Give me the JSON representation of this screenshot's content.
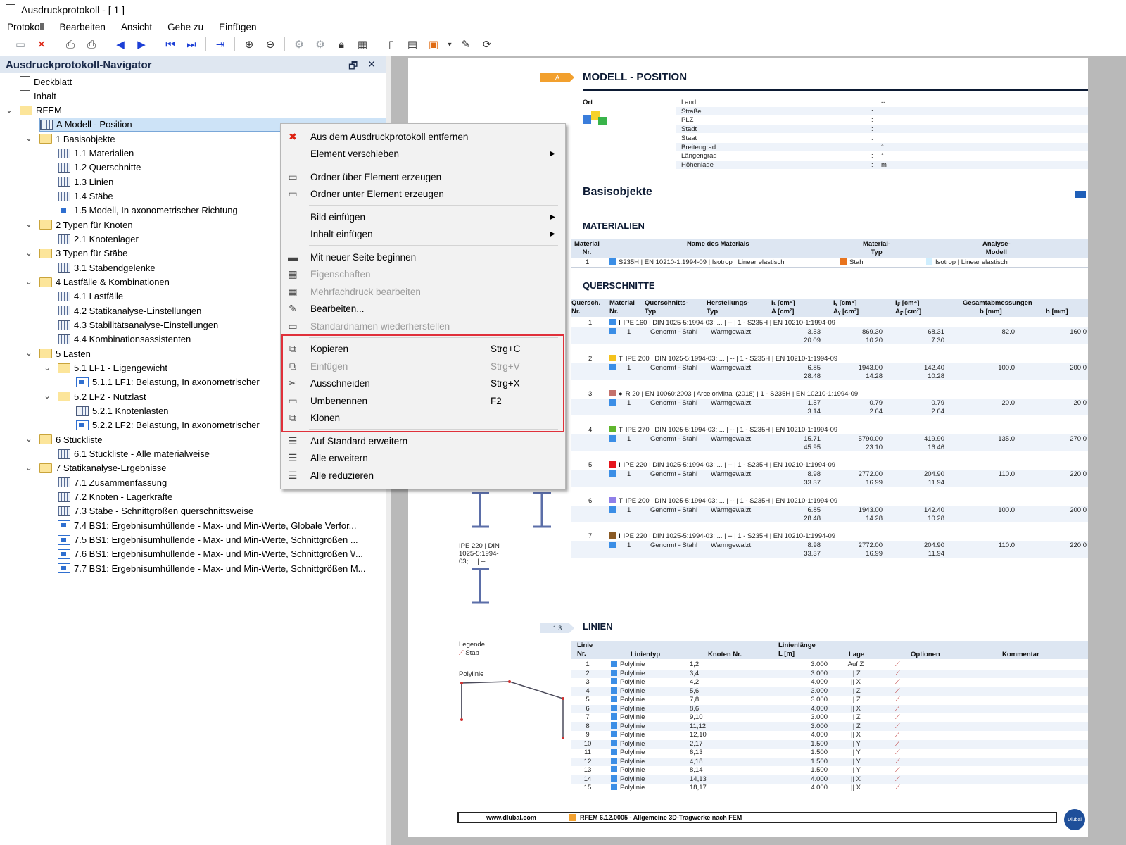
{
  "window": {
    "title": "Ausdruckprotokoll - [ 1 ]"
  },
  "menu": [
    "Protokoll",
    "Bearbeiten",
    "Ansicht",
    "Gehe zu",
    "Einfügen"
  ],
  "navigator": {
    "title": "Ausdruckprotokoll-Navigator",
    "items": [
      {
        "label": "Deckblatt",
        "level": 0,
        "icon": "doc",
        "toggle": ""
      },
      {
        "label": "Inhalt",
        "level": 0,
        "icon": "doc",
        "toggle": ""
      },
      {
        "label": "RFEM",
        "level": 0,
        "icon": "folder",
        "toggle": "v"
      },
      {
        "label": "A Modell - Position",
        "level": 1,
        "icon": "table",
        "toggle": "",
        "selected": true
      },
      {
        "label": "1 Basisobjekte",
        "level": 1,
        "icon": "folder",
        "toggle": "v"
      },
      {
        "label": "1.1 Materialien",
        "level": 2,
        "icon": "table",
        "toggle": ""
      },
      {
        "label": "1.2 Querschnitte",
        "level": 2,
        "icon": "table",
        "toggle": ""
      },
      {
        "label": "1.3 Linien",
        "level": 2,
        "icon": "table",
        "toggle": ""
      },
      {
        "label": "1.4 Stäbe",
        "level": 2,
        "icon": "table",
        "toggle": ""
      },
      {
        "label": "1.5 Modell, In axonometrischer Richtung",
        "level": 2,
        "icon": "img",
        "toggle": ""
      },
      {
        "label": "2 Typen für Knoten",
        "level": 1,
        "icon": "folder",
        "toggle": "v"
      },
      {
        "label": "2.1 Knotenlager",
        "level": 2,
        "icon": "table",
        "toggle": ""
      },
      {
        "label": "3 Typen für Stäbe",
        "level": 1,
        "icon": "folder",
        "toggle": "v"
      },
      {
        "label": "3.1 Stabendgelenke",
        "level": 2,
        "icon": "table",
        "toggle": ""
      },
      {
        "label": "4 Lastfälle & Kombinationen",
        "level": 1,
        "icon": "folder",
        "toggle": "v"
      },
      {
        "label": "4.1 Lastfälle",
        "level": 2,
        "icon": "table",
        "toggle": ""
      },
      {
        "label": "4.2 Statikanalyse-Einstellungen",
        "level": 2,
        "icon": "table",
        "toggle": ""
      },
      {
        "label": "4.3 Stabilitätsanalyse-Einstellungen",
        "level": 2,
        "icon": "table",
        "toggle": ""
      },
      {
        "label": "4.4 Kombinationsassistenten",
        "level": 2,
        "icon": "table",
        "toggle": ""
      },
      {
        "label": "5 Lasten",
        "level": 1,
        "icon": "folder",
        "toggle": "v"
      },
      {
        "label": "5.1 LF1 - Eigengewicht",
        "level": 2,
        "icon": "folder",
        "toggle": "v"
      },
      {
        "label": "5.1.1 LF1: Belastung, In axonometrischer",
        "level": 3,
        "icon": "img",
        "toggle": ""
      },
      {
        "label": "5.2 LF2 - Nutzlast",
        "level": 2,
        "icon": "folder",
        "toggle": "v"
      },
      {
        "label": "5.2.1 Knotenlasten",
        "level": 3,
        "icon": "table",
        "toggle": ""
      },
      {
        "label": "5.2.2 LF2: Belastung, In axonometrischer",
        "level": 3,
        "icon": "img",
        "toggle": ""
      },
      {
        "label": "6 Stückliste",
        "level": 1,
        "icon": "folder",
        "toggle": "v"
      },
      {
        "label": "6.1 Stückliste - Alle materialweise",
        "level": 2,
        "icon": "table",
        "toggle": ""
      },
      {
        "label": "7 Statikanalyse-Ergebnisse",
        "level": 1,
        "icon": "folder",
        "toggle": "v"
      },
      {
        "label": "7.1 Zusammenfassung",
        "level": 2,
        "icon": "table",
        "toggle": ""
      },
      {
        "label": "7.2 Knoten - Lagerkräfte",
        "level": 2,
        "icon": "table",
        "toggle": ""
      },
      {
        "label": "7.3 Stäbe - Schnittgrößen querschnittsweise",
        "level": 2,
        "icon": "table",
        "toggle": ""
      },
      {
        "label": "7.4 BS1: Ergebnisumhüllende - Max- und Min-Werte, Globale Verfor...",
        "level": 2,
        "icon": "img",
        "toggle": ""
      },
      {
        "label": "7.5 BS1: Ergebnisumhüllende - Max- und Min-Werte, Schnittgrößen ...",
        "level": 2,
        "icon": "img",
        "toggle": ""
      },
      {
        "label": "7.6 BS1: Ergebnisumhüllende - Max- und Min-Werte, Schnittgrößen \\/...",
        "level": 2,
        "icon": "img",
        "toggle": ""
      },
      {
        "label": "7.7 BS1: Ergebnisumhüllende - Max- und Min-Werte, Schnittgrößen M...",
        "level": 2,
        "icon": "img",
        "toggle": ""
      }
    ]
  },
  "context_menu": {
    "items": [
      {
        "label": "Aus dem Ausdruckprotokoll entfernen",
        "icon": "remove-icon",
        "disabled": false
      },
      {
        "label": "Element verschieben",
        "submenu": true
      },
      {
        "sep": true
      },
      {
        "label": "Ordner über Element erzeugen",
        "icon": "folder-up-icon"
      },
      {
        "label": "Ordner unter Element erzeugen",
        "icon": "folder-down-icon"
      },
      {
        "sep": true
      },
      {
        "label": "Bild einfügen",
        "submenu": true
      },
      {
        "label": "Inhalt einfügen",
        "submenu": true
      },
      {
        "sep": true
      },
      {
        "label": "Mit neuer Seite beginnen",
        "icon": "new-page-icon"
      },
      {
        "label": "Eigenschaften",
        "icon": "properties-icon",
        "disabled": true
      },
      {
        "label": "Mehrfachdruck bearbeiten",
        "icon": "multi-print-icon",
        "disabled": true
      },
      {
        "label": "Bearbeiten...",
        "icon": "edit-icon"
      },
      {
        "label": "Standardnamen wiederherstellen",
        "icon": "restore-name-icon",
        "disabled": true
      },
      {
        "sep": true
      },
      {
        "label": "Kopieren",
        "shortcut": "Strg+C",
        "icon": "copy-icon"
      },
      {
        "label": "Einfügen",
        "shortcut": "Strg+V",
        "icon": "paste-icon",
        "disabled": true
      },
      {
        "label": "Ausschneiden",
        "shortcut": "Strg+X",
        "icon": "cut-icon"
      },
      {
        "label": "Umbenennen",
        "shortcut": "F2",
        "icon": "rename-icon"
      },
      {
        "label": "Klonen",
        "icon": "clone-icon"
      },
      {
        "sep": true
      },
      {
        "label": "Auf Standard erweitern",
        "icon": "expand-default-icon"
      },
      {
        "label": "Alle erweitern",
        "icon": "expand-all-icon"
      },
      {
        "label": "Alle reduzieren",
        "icon": "collapse-all-icon"
      }
    ]
  },
  "report": {
    "tag_a": "A",
    "section_title": "MODELL - POSITION",
    "ort_label": "Ort",
    "ort_fields": [
      {
        "k": "Land",
        "v": "--"
      },
      {
        "k": "Straße",
        "v": ""
      },
      {
        "k": "PLZ",
        "v": ""
      },
      {
        "k": "Stadt",
        "v": ""
      },
      {
        "k": "Staat",
        "v": ""
      },
      {
        "k": "Breitengrad",
        "v": "°"
      },
      {
        "k": "Längengrad",
        "v": "°"
      },
      {
        "k": "Höhenlage",
        "v": "m"
      }
    ],
    "basis_title": "Basisobjekte",
    "mat_title": "MATERIALIEN",
    "mat_head": [
      "Material\nNr.",
      "Name des Materials",
      "Material-\nTyp",
      "Analyse-\nModell"
    ],
    "mat_row": {
      "nr": "1",
      "name": "S235H | EN 10210-1:1994-09 | Isotrop | Linear elastisch",
      "typ": "Stahl",
      "modell": "Isotrop | Linear elastisch"
    },
    "qs_title": "QUERSCHNITTE",
    "qs_head": [
      "Quersch.\nNr.",
      "Material\nNr.",
      "Querschnitts-\nTyp",
      "Herstellungs-\nTyp",
      "Iₜ [cm⁴]\nA [cm²]",
      "Iᵧ [cm⁴]\nAᵧ [cm²]",
      "I𝓏 [cm⁴]\nA𝓏 [cm²]",
      "Gesamtabmessungen",
      "b [mm]",
      "h [mm]"
    ],
    "qs_rows": [
      {
        "nr": "1",
        "desc": "IPE 160 | DIN 1025-5:1994-03; ... | -- | 1 - S235H | EN 10210-1:1994-09",
        "color": "#3b8ee6",
        "glyph": "I",
        "mat": "1",
        "typ": "Genormt - Stahl",
        "herst": "Warmgewalzt",
        "v1a": "3.53",
        "v1b": "20.09",
        "v2a": "869.30",
        "v2b": "10.20",
        "v3a": "68.31",
        "v3b": "7.30",
        "b": "82.0",
        "h": "160.0"
      },
      {
        "nr": "2",
        "desc": "IPE 200 | DIN 1025-5:1994-03; ... | -- | 1 - S235H | EN 10210-1:1994-09",
        "color": "#f4c21d",
        "glyph": "T",
        "mat": "1",
        "typ": "Genormt - Stahl",
        "herst": "Warmgewalzt",
        "v1a": "6.85",
        "v1b": "28.48",
        "v2a": "1943.00",
        "v2b": "14.28",
        "v3a": "142.40",
        "v3b": "10.28",
        "b": "100.0",
        "h": "200.0"
      },
      {
        "nr": "3",
        "desc": "R 20 | EN 10060:2003 | ArcelorMittal (2018) | 1 - S235H | EN 10210-1:1994-09",
        "color": "#c4726c",
        "glyph": "●",
        "mat": "1",
        "typ": "Genormt - Stahl",
        "herst": "Warmgewalzt",
        "v1a": "1.57",
        "v1b": "3.14",
        "v2a": "0.79",
        "v2b": "2.64",
        "v3a": "0.79",
        "v3b": "2.64",
        "b": "20.0",
        "h": "20.0"
      },
      {
        "nr": "4",
        "desc": "IPE 270 | DIN 1025-5:1994-03; ... | -- | 1 - S235H | EN 10210-1:1994-09",
        "color": "#5fb52d",
        "glyph": "T",
        "mat": "1",
        "typ": "Genormt - Stahl",
        "herst": "Warmgewalzt",
        "v1a": "15.71",
        "v1b": "45.95",
        "v2a": "5790.00",
        "v2b": "23.10",
        "v3a": "419.90",
        "v3b": "16.46",
        "b": "135.0",
        "h": "270.0"
      },
      {
        "nr": "5",
        "desc": "IPE 220 | DIN 1025-5:1994-03; ... | -- | 1 - S235H | EN 10210-1:1994-09",
        "color": "#e5151c",
        "glyph": "I",
        "mat": "1",
        "typ": "Genormt - Stahl",
        "herst": "Warmgewalzt",
        "v1a": "8.98",
        "v1b": "33.37",
        "v2a": "2772.00",
        "v2b": "16.99",
        "v3a": "204.90",
        "v3b": "11.94",
        "b": "110.0",
        "h": "220.0"
      },
      {
        "nr": "6",
        "desc": "IPE 200 | DIN 1025-5:1994-03; ... | -- | 1 - S235H | EN 10210-1:1994-09",
        "color": "#8f7fe8",
        "glyph": "T",
        "mat": "1",
        "typ": "Genormt - Stahl",
        "herst": "Warmgewalzt",
        "v1a": "6.85",
        "v1b": "28.48",
        "v2a": "1943.00",
        "v2b": "14.28",
        "v3a": "142.40",
        "v3b": "10.28",
        "b": "100.0",
        "h": "200.0"
      },
      {
        "nr": "7",
        "desc": "IPE 220 | DIN 1025-5:1994-03; ... | -- | 1 - S235H | EN 10210-1:1994-09",
        "color": "#8a5a24",
        "glyph": "I",
        "mat": "1",
        "typ": "Genormt - Stahl",
        "herst": "Warmgewalzt",
        "v1a": "8.98",
        "v1b": "33.37",
        "v2a": "2772.00",
        "v2b": "16.99",
        "v3a": "204.90",
        "v3b": "11.94",
        "b": "110.0",
        "h": "220.0"
      }
    ],
    "ipe_caption": "IPE 220 | DIN\n1025-5:1994-\n03; ... | --",
    "tag_13": "1.3",
    "lin_title": "LINIEN",
    "legend_title": "Legende",
    "legend_item": "Stab",
    "polylinie_label": "Polylinie",
    "lin_head": [
      "Linie\nNr.",
      "Linientyp",
      "Knoten Nr.",
      "Linienlänge\nL [m]",
      "Lage",
      "Optionen",
      "Kommentar"
    ],
    "lin_rows": [
      {
        "nr": "1",
        "typ": "Polylinie",
        "kn": "1,2",
        "l": "3.000",
        "lage": "Auf Z"
      },
      {
        "nr": "2",
        "typ": "Polylinie",
        "kn": "3,4",
        "l": "3.000",
        "lage": "|| Z"
      },
      {
        "nr": "3",
        "typ": "Polylinie",
        "kn": "4,2",
        "l": "4.000",
        "lage": "|| X"
      },
      {
        "nr": "4",
        "typ": "Polylinie",
        "kn": "5,6",
        "l": "3.000",
        "lage": "|| Z"
      },
      {
        "nr": "5",
        "typ": "Polylinie",
        "kn": "7,8",
        "l": "3.000",
        "lage": "|| Z"
      },
      {
        "nr": "6",
        "typ": "Polylinie",
        "kn": "8,6",
        "l": "4.000",
        "lage": "|| X"
      },
      {
        "nr": "7",
        "typ": "Polylinie",
        "kn": "9,10",
        "l": "3.000",
        "lage": "|| Z"
      },
      {
        "nr": "8",
        "typ": "Polylinie",
        "kn": "11,12",
        "l": "3.000",
        "lage": "|| Z"
      },
      {
        "nr": "9",
        "typ": "Polylinie",
        "kn": "12,10",
        "l": "4.000",
        "lage": "|| X"
      },
      {
        "nr": "10",
        "typ": "Polylinie",
        "kn": "2,17",
        "l": "1.500",
        "lage": "|| Y"
      },
      {
        "nr": "11",
        "typ": "Polylinie",
        "kn": "6,13",
        "l": "1.500",
        "lage": "|| Y"
      },
      {
        "nr": "12",
        "typ": "Polylinie",
        "kn": "4,18",
        "l": "1.500",
        "lage": "|| Y"
      },
      {
        "nr": "13",
        "typ": "Polylinie",
        "kn": "8,14",
        "l": "1.500",
        "lage": "|| Y"
      },
      {
        "nr": "14",
        "typ": "Polylinie",
        "kn": "14,13",
        "l": "4.000",
        "lage": "|| X"
      },
      {
        "nr": "15",
        "typ": "Polylinie",
        "kn": "18,17",
        "l": "4.000",
        "lage": "|| X"
      }
    ],
    "footer_url": "www.dlubal.com",
    "footer_text": "RFEM 6.12.0005 - Allgemeine 3D-Tragwerke nach FEM",
    "logo_text": "Dlubal"
  },
  "colors": {
    "accent_orange": "#f2a02e",
    "header_band": "#dde6f2",
    "highlight_red": "#e0303a",
    "polylinie_swatch": "#3b8ee6"
  }
}
